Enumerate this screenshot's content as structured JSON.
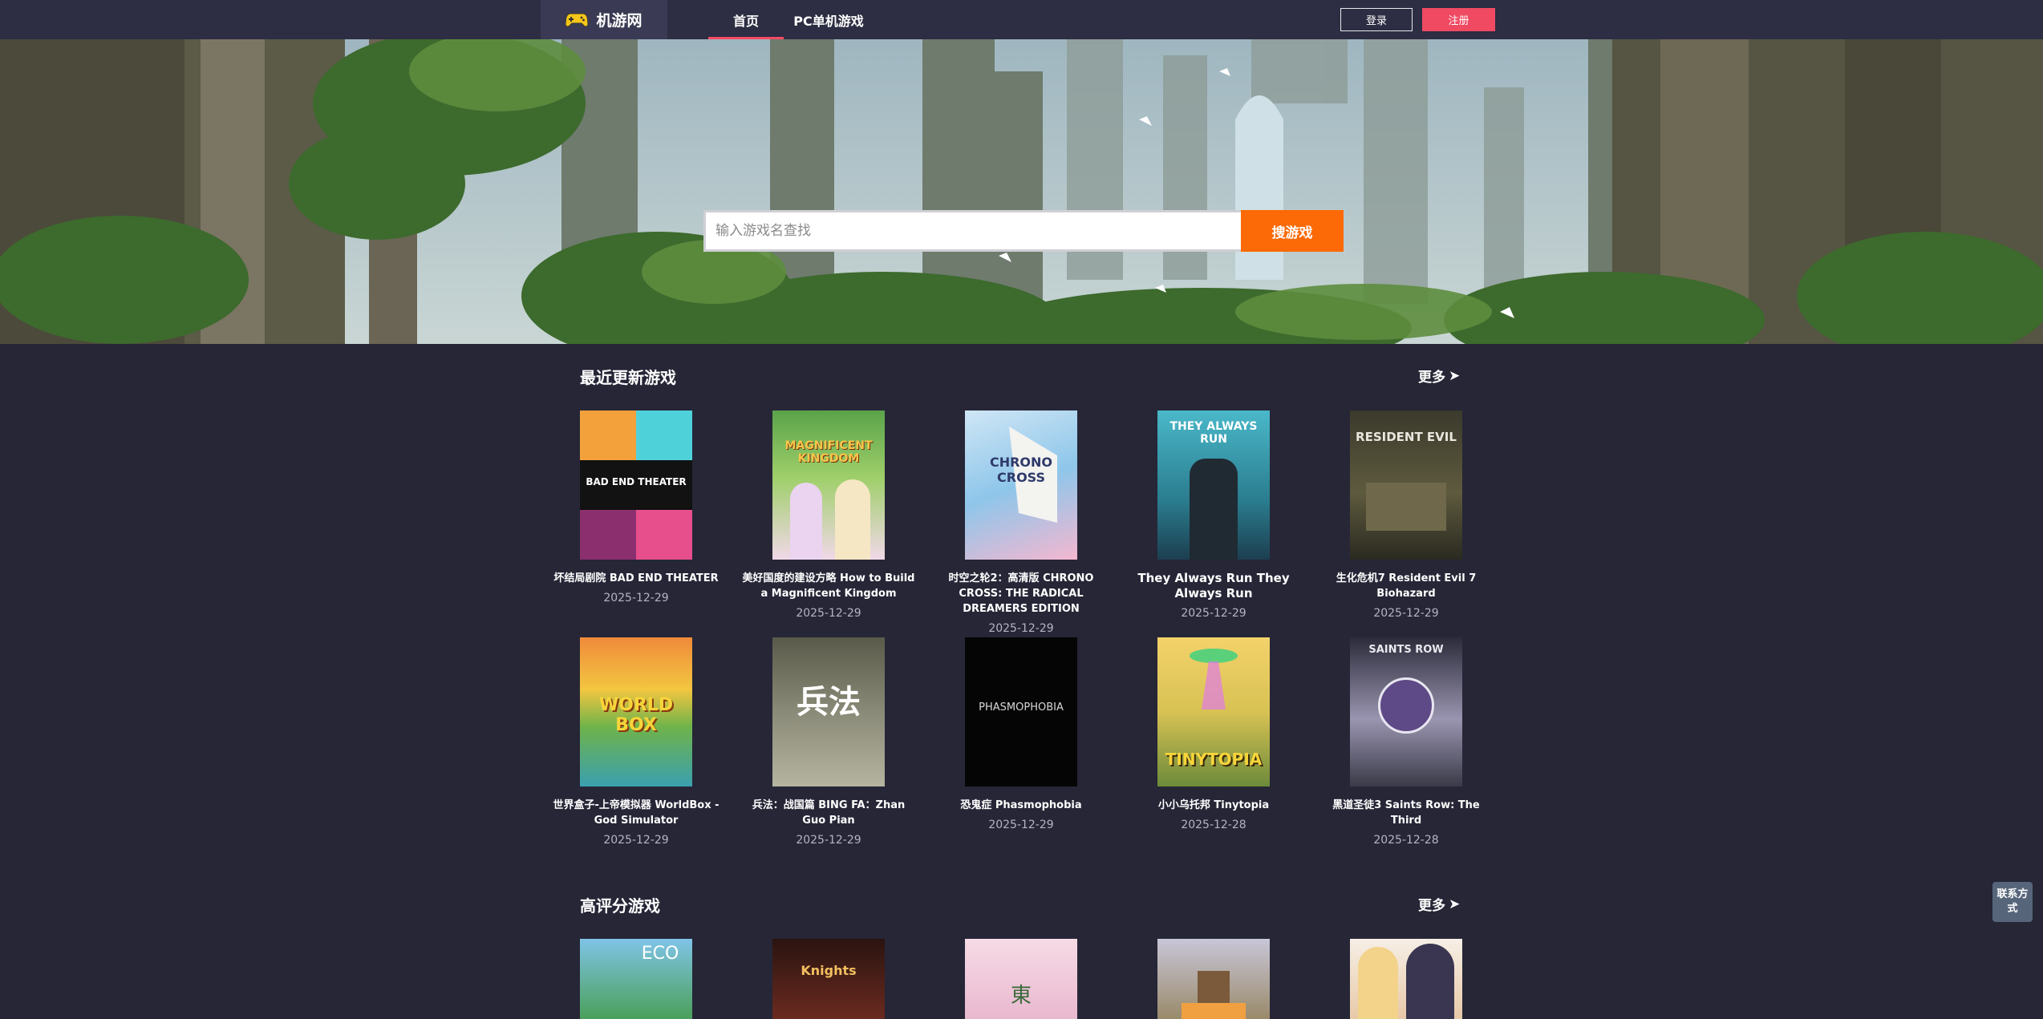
{
  "site": {
    "name": "机游网"
  },
  "nav": {
    "home": "首页",
    "pc_games": "PC单机游戏"
  },
  "auth": {
    "login": "登录",
    "register": "注册"
  },
  "search": {
    "placeholder": "输入游戏名查找",
    "button": "搜游戏"
  },
  "sections": {
    "recent": {
      "title": "最近更新游戏",
      "more": "更多",
      "games": [
        {
          "title": "坏结局剧院 BAD END THEATER",
          "date": "2025-12-29",
          "cover_text": "BAD END THEATER"
        },
        {
          "title": "美好国度的建设方略 How to Build a Magnificent Kingdom",
          "date": "2025-12-29",
          "cover_text": "MAGNIFICENT KINGDOM"
        },
        {
          "title": "时空之轮2：高清版 CHRONO CROSS: THE RADICAL DREAMERS EDITION",
          "date": "2025-12-29",
          "cover_text": "CHRONO CROSS"
        },
        {
          "title": "They Always Run They Always Run",
          "date": "2025-12-29",
          "cover_text": "THEY ALWAYS RUN"
        },
        {
          "title": "生化危机7 Resident Evil 7 Biohazard",
          "date": "2025-12-29",
          "cover_text": "RESIDENT EVIL"
        },
        {
          "title": "世界盒子-上帝模拟器 WorldBox - God Simulator",
          "date": "2025-12-29",
          "cover_text": "WORLD BOX"
        },
        {
          "title": "兵法：战国篇 BING FA：Zhan Guo Pian",
          "date": "2025-12-29",
          "cover_text": "兵法"
        },
        {
          "title": "恐鬼症 Phasmophobia",
          "date": "2025-12-29",
          "cover_text": "PHASMOPHOBIA"
        },
        {
          "title": "小小乌托邦 Tinytopia",
          "date": "2025-12-28",
          "cover_text": "TINYTOPIA"
        },
        {
          "title": "黑道圣徒3 Saints Row: The Third",
          "date": "2025-12-28",
          "cover_text": "SAINTS ROW"
        }
      ]
    },
    "top_rated": {
      "title": "高评分游戏",
      "more": "更多",
      "games": [
        {
          "cover_text": "ECO"
        },
        {
          "cover_text": "Knights"
        },
        {
          "cover_text": "東"
        },
        {
          "cover_text": ""
        },
        {
          "cover_text": ""
        }
      ]
    }
  },
  "contact": {
    "label": "联系方式"
  },
  "colors": {
    "bg": "#262637",
    "nav": "#2d2d43",
    "accent_pink": "#f04a63",
    "accent_orange": "#fb6a06"
  }
}
